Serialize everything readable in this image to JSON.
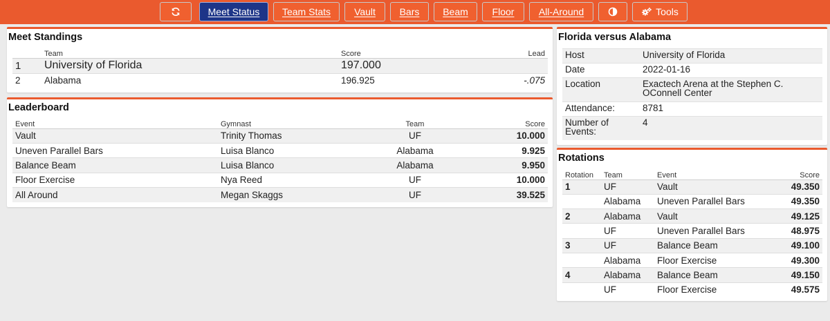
{
  "nav": {
    "meet_status": "Meet Status",
    "team_stats": "Team Stats",
    "vault": "Vault",
    "bars": "Bars",
    "beam": "Beam",
    "floor": "Floor",
    "all_around": "All-Around",
    "tools": "Tools"
  },
  "standings": {
    "title": "Meet Standings",
    "headers": {
      "team": "Team",
      "score": "Score",
      "lead": "Lead"
    },
    "rows": [
      {
        "rank": "1",
        "team": "University of Florida",
        "score": "197.000",
        "lead": ""
      },
      {
        "rank": "2",
        "team": "Alabama",
        "score": "196.925",
        "lead": "-.075"
      }
    ]
  },
  "leaderboard": {
    "title": "Leaderboard",
    "headers": {
      "event": "Event",
      "gymnast": "Gymnast",
      "team": "Team",
      "score": "Score"
    },
    "rows": [
      {
        "event": "Vault",
        "gymnast": "Trinity Thomas",
        "team": "UF",
        "score": "10.000"
      },
      {
        "event": "Uneven Parallel Bars",
        "gymnast": "Luisa Blanco",
        "team": "Alabama",
        "score": "9.925"
      },
      {
        "event": "Balance Beam",
        "gymnast": "Luisa Blanco",
        "team": "Alabama",
        "score": "9.950"
      },
      {
        "event": "Floor Exercise",
        "gymnast": "Nya Reed",
        "team": "UF",
        "score": "10.000"
      },
      {
        "event": "All Around",
        "gymnast": "Megan Skaggs",
        "team": "UF",
        "score": "39.525"
      }
    ]
  },
  "meet_info": {
    "title": "Florida versus Alabama",
    "rows": [
      {
        "label": "Host",
        "value": "University of Florida"
      },
      {
        "label": "Date",
        "value": "2022-01-16"
      },
      {
        "label": "Location",
        "value": "Exactech Arena at the Stephen C. OConnell Center"
      },
      {
        "label": "Attendance:",
        "value": "8781"
      },
      {
        "label": "Number of Events:",
        "value": "4"
      }
    ]
  },
  "rotations": {
    "title": "Rotations",
    "headers": {
      "rotation": "Rotation",
      "team": "Team",
      "event": "Event",
      "score": "Score"
    },
    "rows": [
      {
        "rotation": "1",
        "team": "UF",
        "event": "Vault",
        "score": "49.350"
      },
      {
        "rotation": "",
        "team": "Alabama",
        "event": "Uneven Parallel Bars",
        "score": "49.350"
      },
      {
        "rotation": "2",
        "team": "Alabama",
        "event": "Vault",
        "score": "49.125"
      },
      {
        "rotation": "",
        "team": "UF",
        "event": "Uneven Parallel Bars",
        "score": "48.975"
      },
      {
        "rotation": "3",
        "team": "UF",
        "event": "Balance Beam",
        "score": "49.100"
      },
      {
        "rotation": "",
        "team": "Alabama",
        "event": "Floor Exercise",
        "score": "49.300"
      },
      {
        "rotation": "4",
        "team": "Alabama",
        "event": "Balance Beam",
        "score": "49.150"
      },
      {
        "rotation": "",
        "team": "UF",
        "event": "Floor Exercise",
        "score": "49.575"
      }
    ]
  },
  "icons": {
    "refresh": "refresh-icon",
    "theme": "contrast-icon",
    "tools": "gears-icon"
  },
  "colors": {
    "accent": "#ea5a2e",
    "active": "#1d3588"
  }
}
